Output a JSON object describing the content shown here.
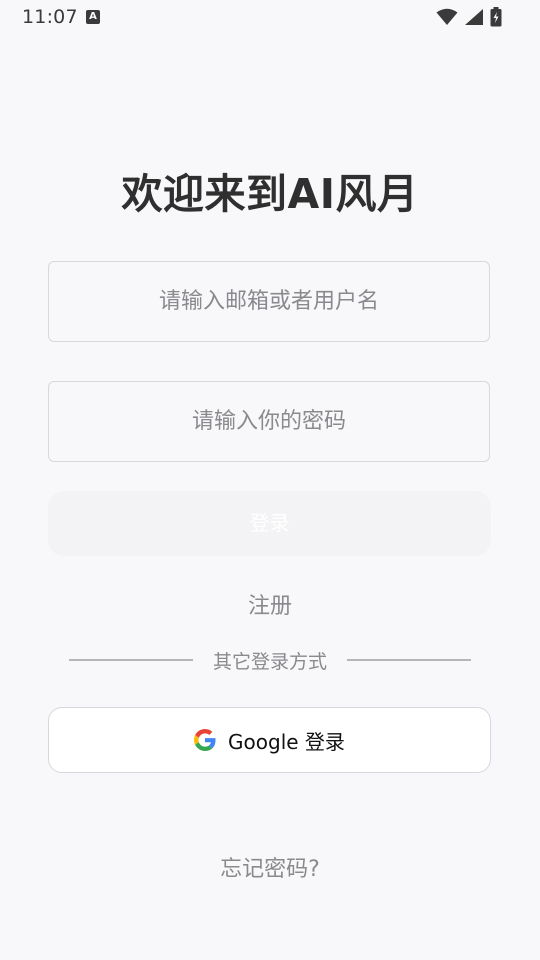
{
  "status_bar": {
    "time": "11:07",
    "notification_icon": "a-icon",
    "wifi_icon": "wifi-icon",
    "signal_icon": "signal-icon",
    "battery_icon": "battery-charging-icon"
  },
  "title": "欢迎来到AI风月",
  "email_input": {
    "placeholder": "请输入邮箱或者用户名",
    "value": ""
  },
  "password_input": {
    "placeholder": "请输入你的密码",
    "value": ""
  },
  "login_button": "登录",
  "register_link": "注册",
  "divider_text": "其它登录方式",
  "google_button": {
    "label": "Google 登录",
    "icon": "google-icon"
  },
  "forgot_password": "忘记密码?",
  "colors": {
    "background": "#f8f8fa",
    "title": "#2f2f2f",
    "muted_text": "#8a8a8e",
    "border": "#d8d8dc",
    "login_button_bg": "#f3f3f5"
  }
}
